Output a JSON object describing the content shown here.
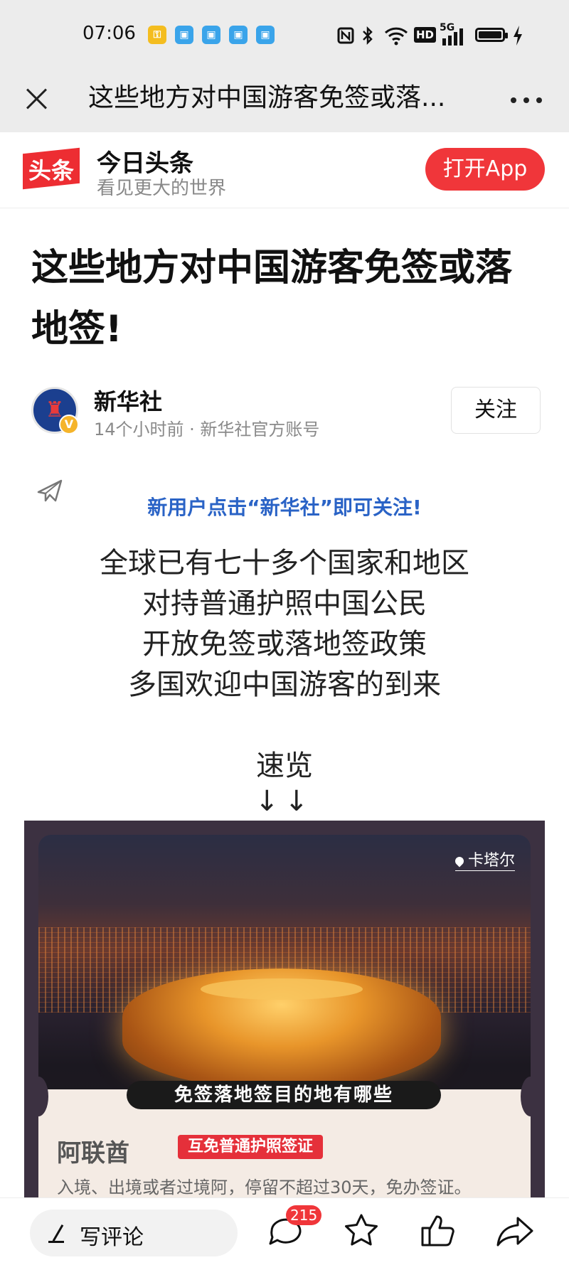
{
  "status_bar": {
    "time": "07:06",
    "notification_icons": [
      "key-notification-icon",
      "app-notification-icon",
      "app-notification-icon",
      "app-notification-icon",
      "app-notification-icon"
    ],
    "system_icons": [
      "nfc-icon",
      "bluetooth-icon",
      "wifi-icon",
      "hd-icon",
      "signal-5g-icon",
      "battery-icon",
      "charging-icon"
    ],
    "hd_label": "HD",
    "network_label": "5G"
  },
  "nav": {
    "title": "这些地方对中国游客免签或落..."
  },
  "banner": {
    "logo_text": "头条",
    "app_name": "今日头条",
    "slogan": "看见更大的世界",
    "open_app_label": "打开App",
    "accent": "#f0363a"
  },
  "article": {
    "title": "这些地方对中国游客免签或落地签!",
    "author": "新华社",
    "meta": "14个小时前 · 新华社官方账号",
    "follow_label": "关注",
    "promo": "新用户点击“新华社”即可关注!",
    "verse": [
      "全球已有七十多个国家和地区",
      "对持普通护照中国公民",
      "开放免签或落地签政策",
      "多国欢迎中国游客的到来"
    ],
    "quick_label": "速览",
    "arrows": "↓↓"
  },
  "image_card": {
    "location": "卡塔尔",
    "ribbon": "免签落地签目的地有哪些",
    "country": "阿联酋",
    "visa_tag": "互免普通护照签证",
    "desc": "入境、出境或者过境阿，停留不超过30天，免办签证。"
  },
  "bottom_bar": {
    "comment_placeholder": "写评论",
    "comment_count": "215"
  }
}
